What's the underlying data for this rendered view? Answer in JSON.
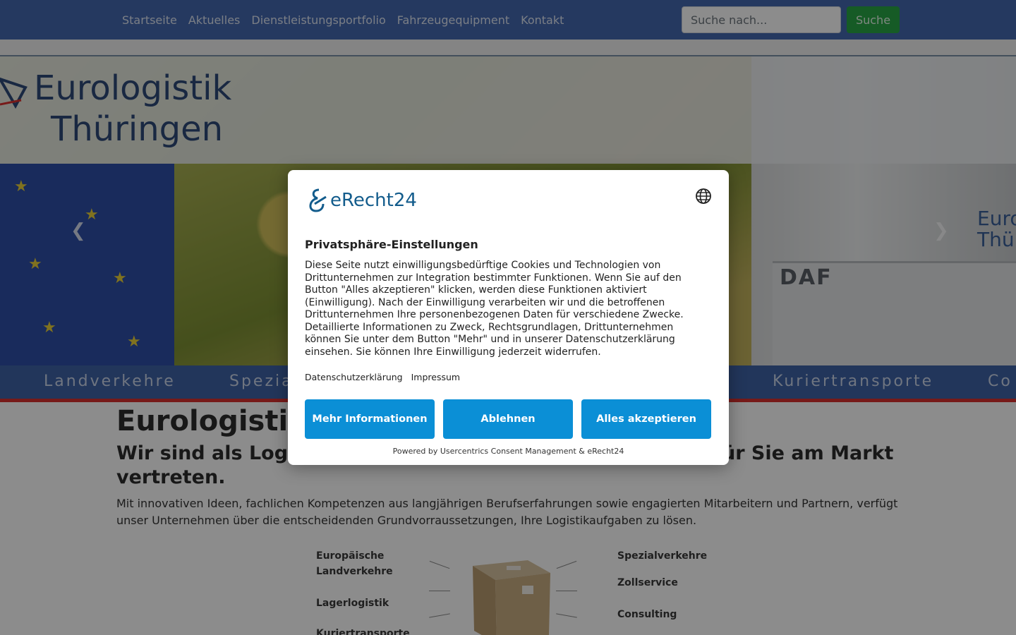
{
  "nav": {
    "links": [
      "Startseite",
      "Aktuelles",
      "Dienstleistungsportfolio",
      "Fahrzeugequipment",
      "Kontakt"
    ],
    "search_placeholder": "Suche nach...",
    "search_button": "Suche"
  },
  "hero": {
    "logo_line1": "Eurologistik",
    "logo_line2": "Thüringen",
    "truck_brand": "DAF",
    "truck_logo_line1": "Euro",
    "truck_logo_line2": "Thü",
    "prev_icon": "chevron-left-icon",
    "next_icon": "chevron-right-icon",
    "services": [
      "Landverkehre",
      "Spezia",
      "Kuriertransporte",
      "Co"
    ]
  },
  "content": {
    "title": "Eurologistik",
    "subtitle_left": "Wir sind als Logis",
    "subtitle_right": "ür Sie am Markt",
    "subtitle_line2": "vertreten.",
    "text": " Mit innovativen Ideen, fachlichen Kompetenzen aus langjährigen Berufserfahrungen sowie engagierten Mitarbeitern und Partnern, verfügt unser Unternehmen über die entscheidenden Grundvorraussetzungen, Ihre Logistikaufgaben zu lösen."
  },
  "graphic": {
    "left": [
      "Europäische",
      "Landverkehre",
      "Lagerlogistik",
      "Kuriertransporte"
    ],
    "right": [
      "Spezialverkehre",
      "Zollservice",
      "Consulting"
    ]
  },
  "consent": {
    "brand": "eRecht24",
    "language_icon": "globe-icon",
    "title": "Privatsphäre-Einstellungen",
    "body": "Diese Seite nutzt einwilligungsbedürftige Cookies und Technologien von Drittunternehmen zur Integration bestimmter Funktionen. Wenn Sie auf den Button \"Alles akzeptieren\" klicken, werden diese Funktionen aktiviert (Einwilligung). Nach der Einwilligung verarbeiten wir und die betroffenen Drittunternehmen Ihre personenbezogenen Daten für verschiedene Zwecke. Detaillierte Informationen zu Zweck, Rechtsgrundlagen, Drittunternehmen können Sie unter dem Button \"Mehr\" und in unserer Datenschutzerklärung einsehen. Sie können Ihre Einwilligung jederzeit widerrufen.",
    "link_privacy": "Datenschutzerklärung",
    "link_imprint": "Impressum",
    "btn_more": "Mehr Informationen",
    "btn_decline": "Ablehnen",
    "btn_accept": "Alles akzeptieren",
    "powered": "Powered by Usercentrics Consent Management & eRecht24",
    "accent_color": "#0b8fd6"
  }
}
